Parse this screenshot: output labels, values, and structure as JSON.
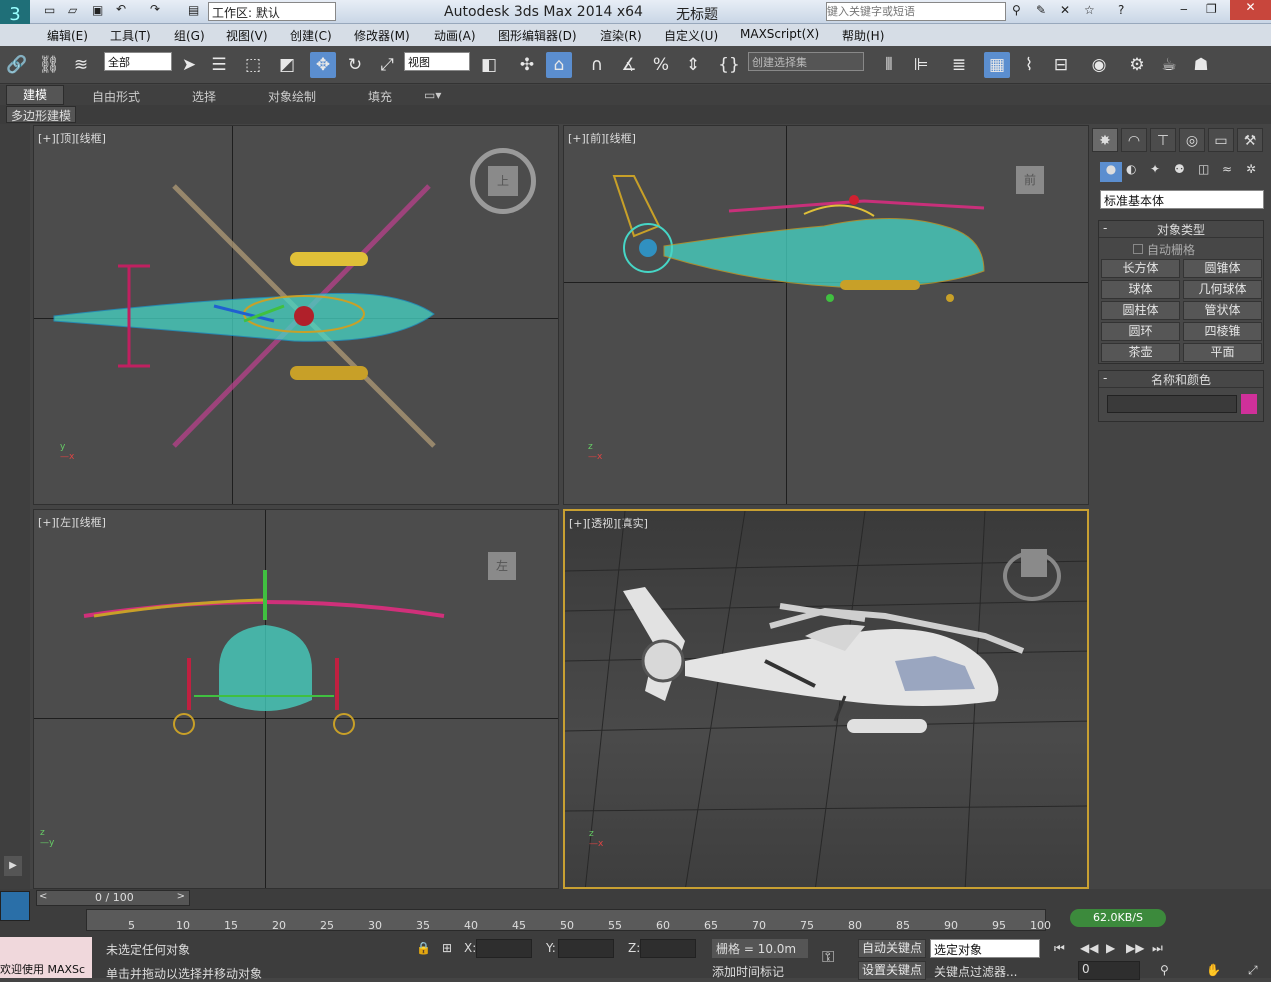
{
  "titlebar": {
    "app_title": "Autodesk 3ds Max  2014 x64",
    "doc_title": "无标题",
    "workspace": "工作区: 默认",
    "search_placeholder": "键入关键字或短语"
  },
  "menu": [
    "编辑(E)",
    "工具(T)",
    "组(G)",
    "视图(V)",
    "创建(C)",
    "修改器(M)",
    "动画(A)",
    "图形编辑器(D)",
    "渲染(R)",
    "自定义(U)",
    "MAXScript(X)",
    "帮助(H)"
  ],
  "toolbar": {
    "selection_filter": "全部",
    "ref_coord": "视图",
    "named_selection": "创建选择集"
  },
  "ribbon": {
    "tabs": [
      "建模",
      "自由形式",
      "选择",
      "对象绘制",
      "填充"
    ],
    "sub_label": "多边形建模"
  },
  "viewports": {
    "top": "[+][顶][线框]",
    "front": "[+][前][线框]",
    "left": "[+][左][线框]",
    "persp": "[+][透视][真实]",
    "cube_top": "上",
    "cube_front": "前",
    "cube_left": "左"
  },
  "cmdpanel": {
    "category": "标准基本体",
    "object_type_title": "对象类型",
    "autogrid": "自动栅格",
    "buttons": [
      "长方体",
      "圆锥体",
      "球体",
      "几何球体",
      "圆柱体",
      "管状体",
      "圆环",
      "四棱锥",
      "茶壶",
      "平面"
    ],
    "name_color_title": "名称和颜色",
    "color": "#d0309a"
  },
  "timeline": {
    "position": "0 / 100",
    "ticks": [
      "5",
      "10",
      "15",
      "20",
      "25",
      "30",
      "35",
      "40",
      "45",
      "50",
      "55",
      "60",
      "65",
      "70",
      "75",
      "80",
      "85",
      "90",
      "95",
      "100"
    ],
    "net_speed": "62.0KB/S"
  },
  "status": {
    "maxscript": "欢迎使用 MAXSc",
    "selection": "未选定任何对象",
    "prompt": "单击并拖动以选择并移动对象",
    "x_label": "X:",
    "y_label": "Y:",
    "z_label": "Z:",
    "grid": "栅格 = 10.0m",
    "add_time_tag": "添加时间标记",
    "auto_key": "自动关键点",
    "set_key": "设置关键点",
    "selected_object": "选定对象",
    "key_filter": "关键点过滤器...",
    "frame": "0"
  }
}
